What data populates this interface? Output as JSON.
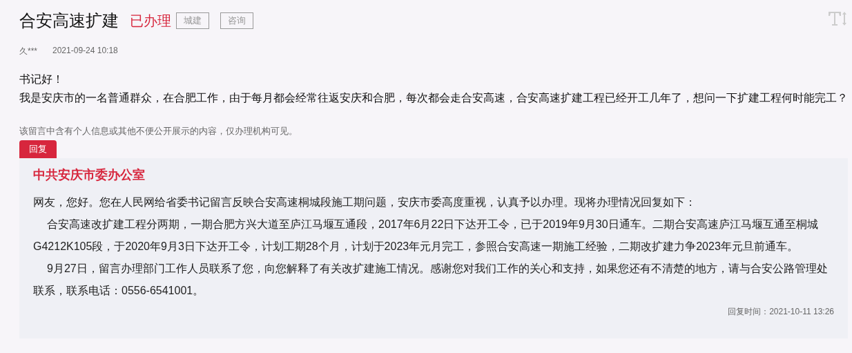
{
  "title": "合安高速扩建",
  "status": "已办理",
  "tags": [
    "城建",
    "咨询"
  ],
  "author": "久***",
  "posted_at": "2021-09-24 10:18",
  "message": [
    "书记好！",
    "我是安庆市的一名普通群众，在合肥工作，由于每月都会经常往返安庆和合肥，每次都会走合安高速，合安高速扩建工程已经开工几年了，想问一下扩建工程何时能完工？"
  ],
  "privacy_note": "该留言中含有个人信息或其他不便公开展示的内容，仅办理机构可见。",
  "reply": {
    "label": "回复",
    "department": "中共安庆市委办公室",
    "paragraphs": [
      {
        "text": "网友，您好。您在人民网给省委书记留言反映合安高速桐城段施工期问题，安庆市委高度重视，认真予以办理。现将办理情况回复如下：",
        "indent": false
      },
      {
        "text": "合安高速改扩建工程分两期，一期合肥方兴大道至庐江马堰互通段，2017年6月22日下达开工令，已于2019年9月30日通车。二期合安高速庐江马堰互通至桐城G4212K105段，于2020年9月3日下达开工令，计划工期28个月，计划于2023年元月完工，参照合安高速一期施工经验，二期改扩建力争2023年元旦前通车。",
        "indent": true
      },
      {
        "text": "9月27日，留言办理部门工作人员联系了您，向您解释了有关改扩建施工情况。感谢您对我们工作的关心和支持，如果您还有不清楚的地方，请与合安公路管理处联系，联系电话：0556-6541001。",
        "indent": true
      }
    ],
    "time": "回复时间：2021-10-11 13:26"
  }
}
